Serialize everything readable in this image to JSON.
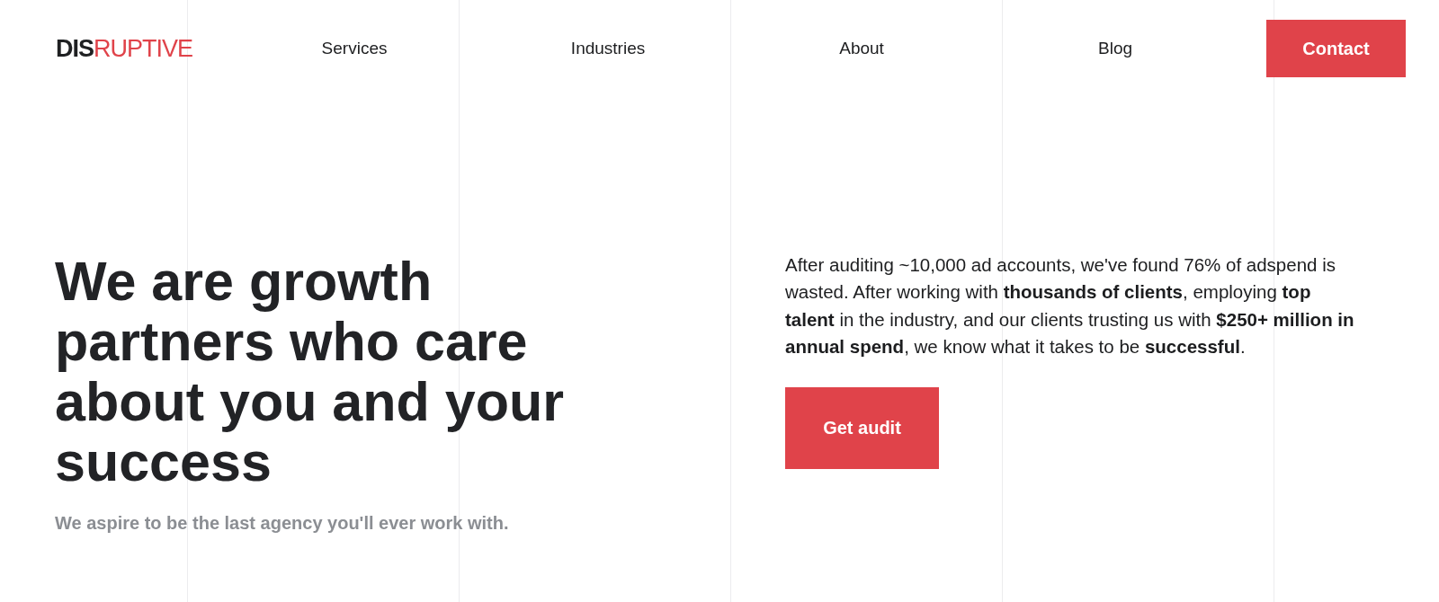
{
  "header": {
    "logo": {
      "dark": "DIS",
      "accent": "RUPTIVE"
    },
    "nav": [
      "Services",
      "Industries",
      "About",
      "Blog"
    ],
    "cta": {
      "label": "Contact"
    }
  },
  "hero": {
    "headline": "We are growth partners who care about you and your success",
    "tagline": "We aspire to be the last agency you'll ever work with.",
    "intro": "After auditing ~10,000 ad accounts, we've found 76% of adspend is wasted. After working with **thousands of clients**, employing **top talent** in the industry, and our clients trusting us with **$250+ million in annual spend**, we know what it takes to be **successful**.",
    "button": {
      "label": "Get audit"
    }
  }
}
